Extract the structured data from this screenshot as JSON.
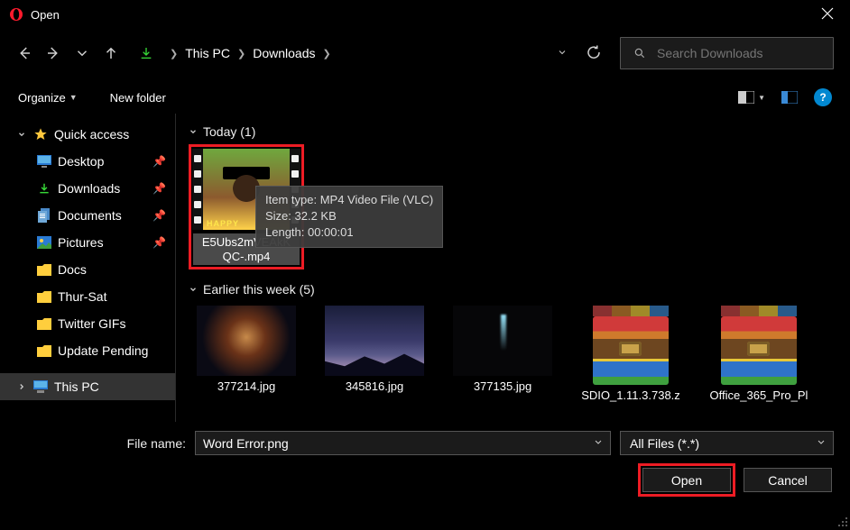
{
  "title": "Open",
  "breadcrumb": {
    "root": "This PC",
    "folder": "Downloads"
  },
  "search": {
    "placeholder": "Search Downloads"
  },
  "toolbar": {
    "organize": "Organize",
    "new_folder": "New folder"
  },
  "sidebar": {
    "quick_access": "Quick access",
    "items": [
      {
        "label": "Desktop"
      },
      {
        "label": "Downloads"
      },
      {
        "label": "Documents"
      },
      {
        "label": "Pictures"
      },
      {
        "label": "Docs"
      },
      {
        "label": "Thur-Sat"
      },
      {
        "label": "Twitter GIFs"
      },
      {
        "label": "Update Pending"
      }
    ],
    "this_pc": "This PC"
  },
  "groups": {
    "today": {
      "label": "Today (1)"
    },
    "earlier": {
      "label": "Earlier this week (5)"
    }
  },
  "selected_file": {
    "name": "E5Ubs2mVEAkKQC-.mp4",
    "overlay_text": "HAPPY",
    "tooltip_type": "Item type: MP4 Video File (VLC)",
    "tooltip_size": "Size: 32.2 KB",
    "tooltip_length": "Length: 00:00:01"
  },
  "earlier_files": [
    {
      "name": "377214.jpg"
    },
    {
      "name": "345816.jpg"
    },
    {
      "name": "377135.jpg"
    },
    {
      "name": "SDIO_1.11.3.738.z"
    },
    {
      "name": "Office_365_Pro_Pl"
    }
  ],
  "file_name": {
    "label": "File name:",
    "value": "Word Error.png"
  },
  "filter": {
    "value": "All Files (*.*)"
  },
  "buttons": {
    "open": "Open",
    "cancel": "Cancel"
  }
}
